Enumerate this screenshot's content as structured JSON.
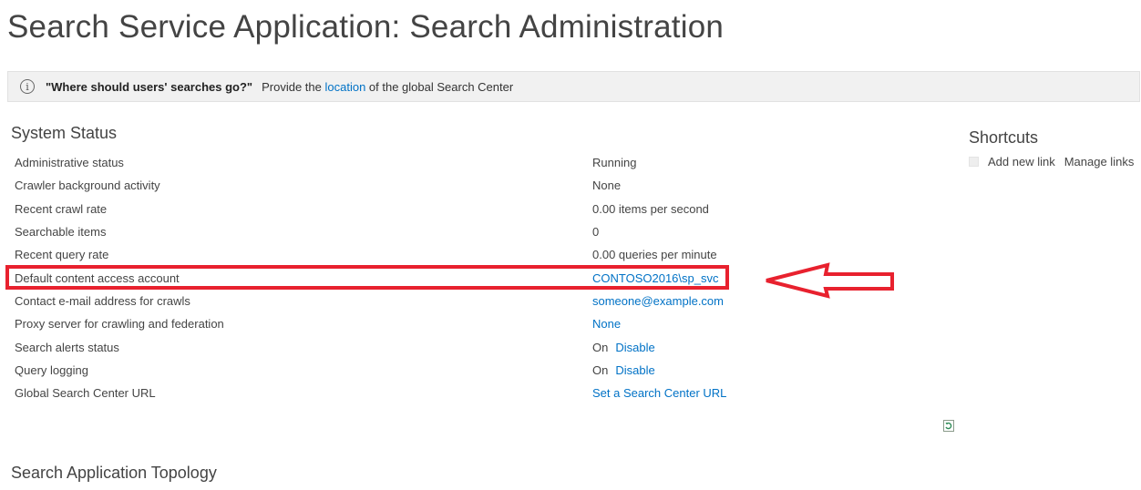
{
  "page": {
    "title": "Search Service Application: Search Administration"
  },
  "info_bar": {
    "question": "\"Where should users' searches go?\"",
    "text_before": "Provide the",
    "link_text": "location",
    "text_after": "of the global Search Center"
  },
  "system_status": {
    "title": "System Status",
    "rows": [
      {
        "label": "Administrative status",
        "value": "Running"
      },
      {
        "label": "Crawler background activity",
        "value": "None"
      },
      {
        "label": "Recent crawl rate",
        "value": "0.00 items per second"
      },
      {
        "label": "Searchable items",
        "value": "0"
      },
      {
        "label": "Recent query rate",
        "value": "0.00 queries per minute"
      },
      {
        "label": "Default content access account",
        "link": "CONTOSO2016\\sp_svc"
      },
      {
        "label": "Contact e-mail address for crawls",
        "link": "someone@example.com"
      },
      {
        "label": "Proxy server for crawling and federation",
        "link": "None"
      },
      {
        "label": "Search alerts status",
        "value": "On",
        "link": "Disable"
      },
      {
        "label": "Query logging",
        "value": "On",
        "link": "Disable"
      },
      {
        "label": "Global Search Center URL",
        "link": "Set a Search Center URL"
      }
    ]
  },
  "shortcuts": {
    "title": "Shortcuts",
    "add_new_link": "Add new link",
    "manage_links": "Manage links"
  },
  "topology": {
    "title": "Search Application Topology"
  },
  "colors": {
    "link": "#0072c6",
    "highlight": "#e8212e",
    "info_bar_bg": "#f1f1f1"
  },
  "icons": {
    "info": "info-circle-icon",
    "refresh": "refresh-icon"
  }
}
